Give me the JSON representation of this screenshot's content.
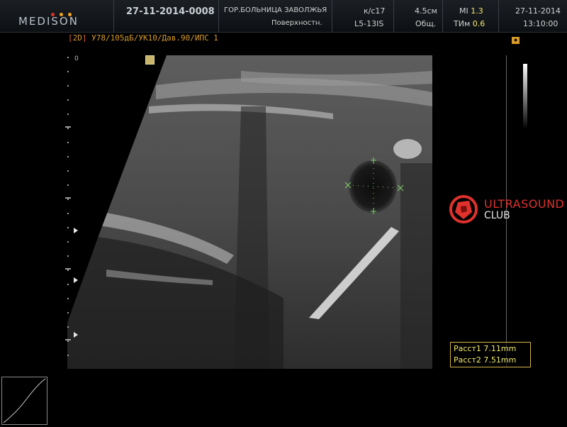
{
  "brand": {
    "name": "MEDISON",
    "dot_colors": [
      "#e0312c",
      "#f2a41c",
      "#f2a41c"
    ]
  },
  "header": {
    "patient_id": "27-11-2014-0008",
    "institution": "ГОР.БОЛЬНИЦА ЗАВОЛЖЬЯ",
    "preset": "Поверхностн.",
    "frame_rate": "к/с17",
    "probe": "L5-13IS",
    "depth": "4.5см",
    "app_mode": "Общ.",
    "mi_label": "MI",
    "mi_value": "1.3",
    "tim_label": "ТИм",
    "tim_value": "0.6",
    "date": "27-11-2014",
    "time": "13:10:00"
  },
  "image": {
    "mode_tag": "2D",
    "params": "У78/105дБ/УК10/Дав.90/ИПС 1",
    "depth_zero": "0"
  },
  "measurements": [
    {
      "label": "Расст1",
      "value": "7.11mm"
    },
    {
      "label": "Расст2",
      "value": "7.51mm"
    }
  ],
  "watermark": {
    "line1": "ULTRASOUND",
    "line2": "CLUB",
    "color": "#e0312c"
  }
}
